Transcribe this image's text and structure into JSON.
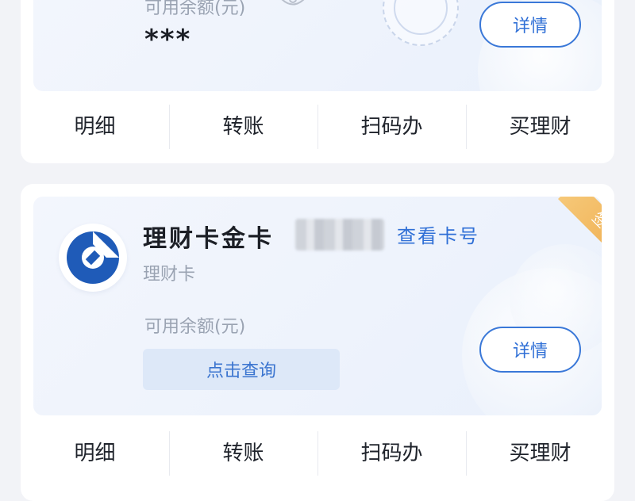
{
  "colors": {
    "accent_blue": "#2f6fd6",
    "bank_logo_blue": "#1f5bb8",
    "tag_orange": "#eeaa4a",
    "grey_text": "#9aa3b2",
    "title_text": "#1c1f26"
  },
  "card1": {
    "balance_label": "可用余额(元)",
    "balance_value": "***",
    "detail_label": "详情",
    "actions": [
      "明细",
      "转账",
      "扫码办",
      "买理财"
    ]
  },
  "card2": {
    "title": "理财卡金卡",
    "view_card_number": "查看卡号",
    "subtype": "理财卡",
    "signed_tag": "签约",
    "balance_label": "可用余额(元)",
    "query_label": "点击查询",
    "detail_label": "详情",
    "actions": [
      "明细",
      "转账",
      "扫码办",
      "买理财"
    ]
  },
  "icons": {
    "bank_logo": "ccb-bank-logo-icon",
    "eye": "eye-visibility-icon",
    "stamp": "seal-stamp-icon"
  }
}
